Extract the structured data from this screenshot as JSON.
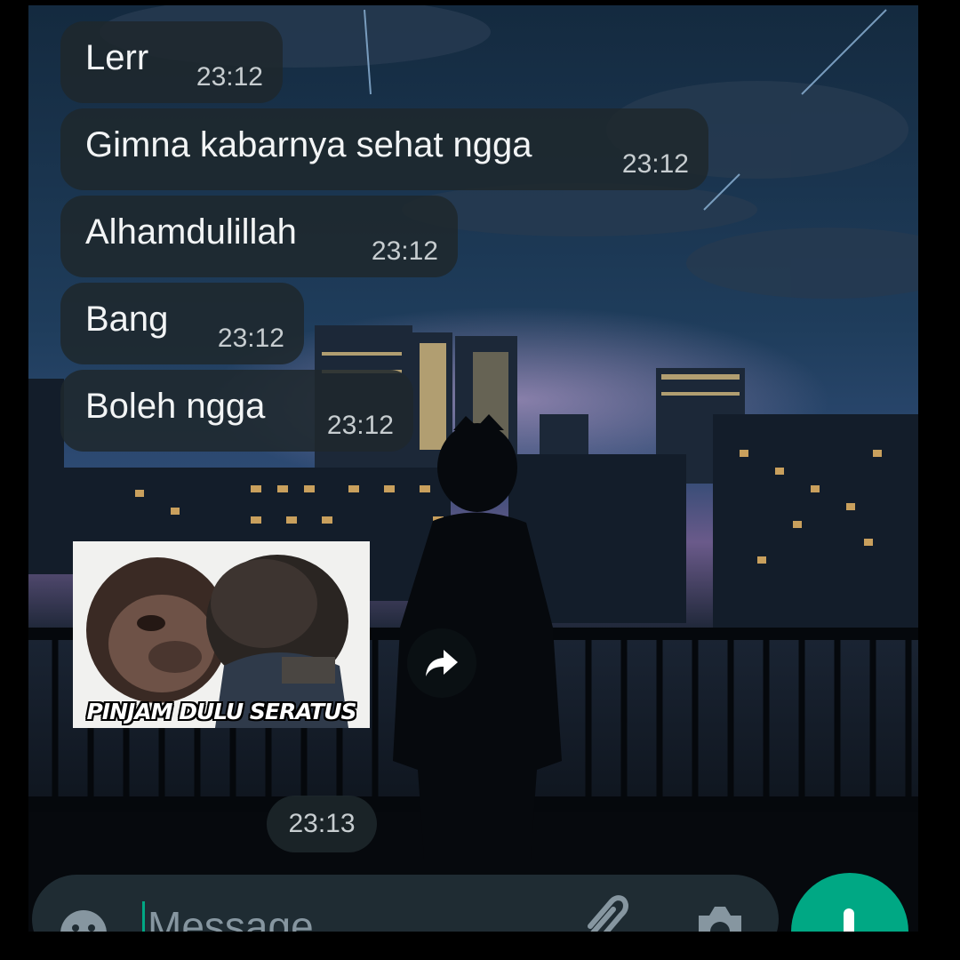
{
  "messages": [
    {
      "text": "Lerr",
      "time": "23:12"
    },
    {
      "text": "Gimna kabarnya sehat ngga",
      "time": "23:12"
    },
    {
      "text": "Alhamdulillah",
      "time": "23:12"
    },
    {
      "text": "Bang",
      "time": "23:12"
    },
    {
      "text": "Boleh ngga",
      "time": "23:12"
    }
  ],
  "sticker": {
    "caption": "PINJAM DULU SERATUS",
    "time": "23:13"
  },
  "composer": {
    "placeholder": "Message",
    "send_color": "#00a884"
  },
  "icons": {
    "forward": "forward-arrow-icon",
    "emoji": "emoji-icon",
    "attach": "paperclip-icon",
    "camera": "camera-icon",
    "mic": "mic-icon"
  },
  "colors": {
    "bubble": "#1e282c",
    "accent": "#00a884",
    "time_text": "#c7cdd0"
  }
}
